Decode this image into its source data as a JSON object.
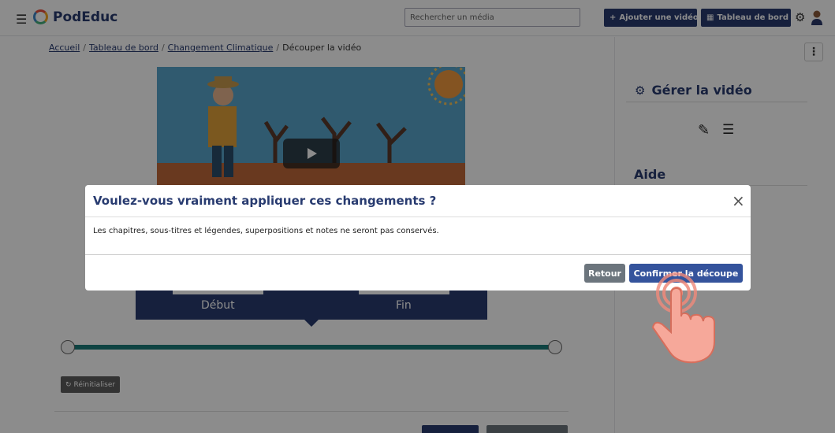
{
  "header": {
    "brand": "PodEduc",
    "search_placeholder": "Rechercher un média",
    "add_video_label": "Ajouter une vidéo",
    "dashboard_label": "Tableau de bord"
  },
  "breadcrumb": {
    "home": "Accueil",
    "dashboard": "Tableau de bord",
    "video": "Changement Climatique",
    "current": "Découper la vidéo"
  },
  "cut": {
    "start_label": "Début",
    "end_label": "Fin",
    "reset_label": "Réinitialiser"
  },
  "sidebar": {
    "manage_title": "Gérer la vidéo",
    "help_title": "Aide"
  },
  "modal": {
    "title": "Voulez-vous vraiment appliquer ces changements ?",
    "body": "Les chapitres, sous-titres et légendes, superpositions et notes ne seront pas conservés.",
    "back_label": "Retour",
    "confirm_label": "Confirmer la découpe"
  },
  "colors": {
    "primary": "#283b70",
    "teal": "#1b7a78",
    "grey_button": "#6c757d"
  },
  "icons": [
    "menu-icon",
    "gear-icon",
    "play-icon",
    "edit-icon",
    "list-icon",
    "close-icon",
    "reset-icon",
    "pointer-hand-icon"
  ]
}
